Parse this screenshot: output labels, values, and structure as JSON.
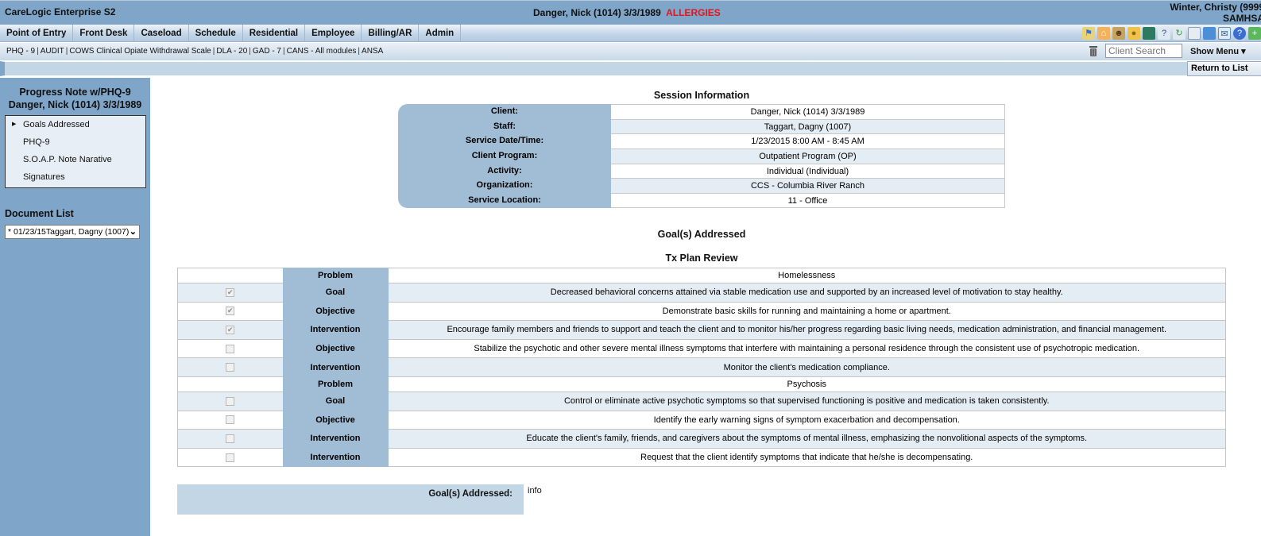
{
  "app": {
    "title": "CareLogic Enterprise S2",
    "patient_header": "Danger, Nick (1014) 3/3/1989",
    "allergy_flag": "ALLERGIES",
    "allergy_color": "#e4141b",
    "user_line1": "Winter, Christy (9999",
    "user_line2": "SAMHSA"
  },
  "menu": {
    "items": [
      "Point of Entry",
      "Front Desk",
      "Caseload",
      "Schedule",
      "Residential",
      "Employee",
      "Billing/AR",
      "Admin"
    ]
  },
  "toolbar_icons": [
    "flag-icon",
    "home-icon",
    "users-icon",
    "lock-icon",
    "green-box-icon",
    "word-help-icon",
    "refresh-icon",
    "frame-icon",
    "document-icon",
    "mail-icon",
    "help-icon",
    "add-icon"
  ],
  "assessments": {
    "links": [
      "PHQ - 9",
      "AUDIT",
      "COWS Clinical Opiate Withdrawal Scale",
      "DLA - 20",
      "GAD - 7",
      "CANS - All modules",
      "ANSA"
    ],
    "separator": "|"
  },
  "search": {
    "placeholder": "Client Search",
    "value": "Client Search"
  },
  "show_menu_label": "Show Menu ▾",
  "return_label": "Return to List",
  "sidebar": {
    "title_line1": "Progress Note w/PHQ-9",
    "title_line2": "Danger, Nick (1014) 3/3/1989",
    "nav": [
      {
        "label": "Goals Addressed",
        "active": true
      },
      {
        "label": "PHQ-9",
        "active": false
      },
      {
        "label": "S.O.A.P. Note Narative",
        "active": false
      },
      {
        "label": "Signatures",
        "active": false
      }
    ],
    "doc_list_label": "Document List",
    "doc_selected": "* 01/23/15Taggart, Dagny (1007)"
  },
  "session": {
    "title": "Session Information",
    "rows": [
      {
        "label": "Client:",
        "value": "Danger, Nick (1014) 3/3/1989"
      },
      {
        "label": "Staff:",
        "value": "Taggart, Dagny (1007)"
      },
      {
        "label": "Service Date/Time:",
        "value": "1/23/2015 8:00 AM - 8:45 AM"
      },
      {
        "label": "Client Program:",
        "value": "Outpatient Program (OP)"
      },
      {
        "label": "Activity:",
        "value": "Individual (Individual)"
      },
      {
        "label": "Organization:",
        "value": "CCS - Columbia River Ranch"
      },
      {
        "label": "Service Location:",
        "value": "11 - Office"
      }
    ]
  },
  "goals": {
    "section_title": "Goal(s) Addressed",
    "table_title": "Tx Plan Review",
    "rows": [
      {
        "kind": "problem",
        "type": "Problem",
        "text": "Homelessness",
        "checked": null
      },
      {
        "kind": "item",
        "type": "Goal",
        "text": "Decreased behavioral concerns attained via stable medication use and supported by an increased level of motivation to stay healthy.",
        "checked": true
      },
      {
        "kind": "item",
        "type": "Objective",
        "text": "Demonstrate basic skills for running and maintaining a home or apartment.",
        "checked": true
      },
      {
        "kind": "item",
        "type": "Intervention",
        "text": "Encourage family members and friends to support and teach the client and to monitor his/her progress regarding basic living needs, medication administration, and financial management.",
        "checked": true
      },
      {
        "kind": "item",
        "type": "Objective",
        "text": "Stabilize the psychotic and other severe mental illness symptoms that interfere with maintaining a personal residence through the consistent use of psychotropic medication.",
        "checked": false
      },
      {
        "kind": "item",
        "type": "Intervention",
        "text": "Monitor the client's medication compliance.",
        "checked": false
      },
      {
        "kind": "problem",
        "type": "Problem",
        "text": "Psychosis",
        "checked": null
      },
      {
        "kind": "item",
        "type": "Goal",
        "text": "Control or eliminate active psychotic symptoms so that supervised functioning is positive and medication is taken consistently.",
        "checked": false
      },
      {
        "kind": "item",
        "type": "Objective",
        "text": "Identify the early warning signs of symptom exacerbation and decompensation.",
        "checked": false
      },
      {
        "kind": "item",
        "type": "Intervention",
        "text": "Educate the client's family, friends, and caregivers about the symptoms of mental illness, emphasizing the nonvolitional aspects of the symptoms.",
        "checked": false
      },
      {
        "kind": "item",
        "type": "Intervention",
        "text": "Request that the client identify symptoms that indicate that he/she is decompensating.",
        "checked": false
      }
    ],
    "field_label": "Goal(s) Addressed:",
    "field_value": "info"
  }
}
